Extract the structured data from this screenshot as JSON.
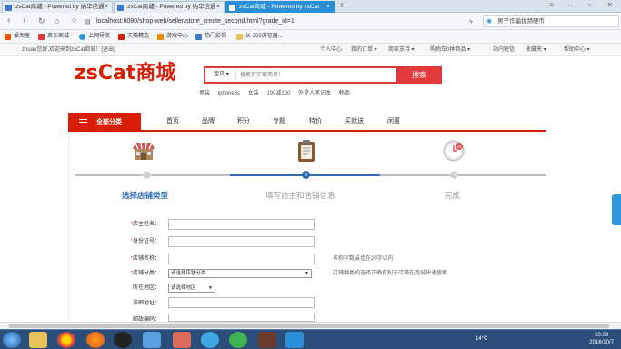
{
  "browser": {
    "tabs": [
      {
        "label": "zsCat商城 - Powered by 纳华信通",
        "active": false
      },
      {
        "label": "zsCat商城 - Powered by 纳华信通",
        "active": false
      },
      {
        "label": "zsCat商城 - Powered by zsCat",
        "active": true
      }
    ],
    "new_tab": "+",
    "url": "localhost:8080/shop-web/seller/store_create_second.html?grade_id=1",
    "search_text": "男子诈骗扰频硬币",
    "bookmarks": [
      "爱淘宝",
      "京东商城",
      "上网导航",
      "天猫精选",
      "游戏中心",
      "热门影视",
      "从 360浏览器..."
    ]
  },
  "site_top": {
    "welcome": "zhuan您好,欢迎来到zsCat商城！[退出]",
    "links": [
      "个人中心",
      "我的订单 ▾",
      "商家支持 ▾",
      "购物车0种商品 ▾",
      "站内短信",
      "收藏夹 ▾",
      "帮助中心 ▾"
    ]
  },
  "header": {
    "logo": "zsCat商城",
    "search_category": "宝贝",
    "search_placeholder": "搜索其实很简单！",
    "search_button": "搜索",
    "hot_words": [
      "男装",
      "iphone6s",
      "女装",
      "199减100",
      "外星人笔记本",
      "韩都"
    ]
  },
  "nav": {
    "all_categories": "全部分类",
    "items": [
      "首页",
      "品牌",
      "积分",
      "专题",
      "特价",
      "买就送",
      "闲置"
    ]
  },
  "steps": [
    {
      "num": "1",
      "label": "选择店铺类型",
      "icon": "store-icon",
      "state": "done"
    },
    {
      "num": "2",
      "label": "填写店主和店铺信息",
      "icon": "clipboard-icon",
      "state": "current"
    },
    {
      "num": "3",
      "label": "完成",
      "icon": "24h-clock-icon",
      "state": "pending"
    }
  ],
  "form": {
    "fields": [
      {
        "label": "店主姓名：",
        "required": true,
        "type": "text"
      },
      {
        "label": "身份证号：",
        "required": true,
        "type": "text"
      },
      {
        "label": "店铺名称：",
        "required": true,
        "type": "text",
        "hint": "名称字数最佳在20字以内"
      },
      {
        "label": "店铺分类：",
        "required": true,
        "type": "select",
        "value": "请选择店铺分类",
        "hint": "店铺种类的选择正确有利于店铺在商城快速搜索"
      },
      {
        "label": "所在地区：",
        "required": false,
        "type": "select",
        "value": "请选择地区"
      },
      {
        "label": "详细地址：",
        "required": false,
        "type": "text"
      },
      {
        "label": "邮政编码：",
        "required": false,
        "type": "text"
      }
    ]
  },
  "taskbar": {
    "temperature": "14°C",
    "time": "20:39",
    "date": "2016/10/7"
  },
  "colors": {
    "brand_red": "#d81e06",
    "search_red": "#e23a3a",
    "step_active_blue": "#2f6db5",
    "taskbar": "#2b4d7a"
  }
}
